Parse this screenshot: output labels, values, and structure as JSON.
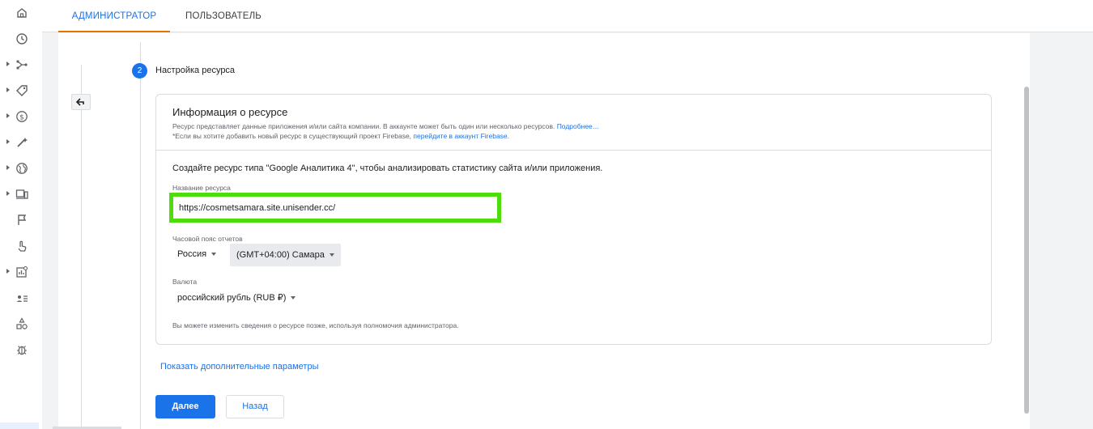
{
  "colors": {
    "accent": "#1a73e8",
    "tab_indicator": "#e37400",
    "highlight": "#4cdd0b",
    "text": "#202124",
    "muted": "#5f6368"
  },
  "sidebar": {
    "items": [
      {
        "icon": "home-icon",
        "expandable": false
      },
      {
        "icon": "clock-icon",
        "expandable": false
      },
      {
        "icon": "branch-icon",
        "expandable": true
      },
      {
        "icon": "tag-icon",
        "expandable": true
      },
      {
        "icon": "dollar-icon",
        "expandable": true
      },
      {
        "icon": "wand-icon",
        "expandable": true
      },
      {
        "icon": "globe-icon",
        "expandable": true
      },
      {
        "icon": "devices-icon",
        "expandable": true
      },
      {
        "icon": "flag-icon",
        "expandable": false
      },
      {
        "icon": "touch-icon",
        "expandable": false
      },
      {
        "icon": "report-icon",
        "expandable": true
      },
      {
        "icon": "user-list-icon",
        "expandable": false
      },
      {
        "icon": "shapes-icon",
        "expandable": false
      },
      {
        "icon": "bug-icon",
        "expandable": false
      }
    ]
  },
  "tabs": {
    "admin": "Администратор",
    "user": "Пользователь"
  },
  "step": {
    "number": "2",
    "title": "Настройка ресурса"
  },
  "card": {
    "title": "Информация о ресурсе",
    "desc1": "Ресурс представляет данные приложения и/или сайта компании. В аккаунте может быть один или несколько ресурсов. ",
    "desc1_link": "Подробнее…",
    "desc2": "*Если вы хотите добавить новый ресурс в существующий проект Firebase, ",
    "desc2_link": "перейдите в аккаунт Firebase",
    "desc2_end": ".",
    "intro": "Создайте ресурс типа \"Google Аналитика 4\", чтобы анализировать статистику сайта и/или приложения.",
    "name_label": "Название ресурса",
    "name_value": "https://cosmetsamara.site.unisender.cc/",
    "tz_label": "Часовой пояс отчетов",
    "country": "Россия",
    "timezone": "(GMT+04:00) Самара",
    "currency_label": "Валюта",
    "currency": "российский рубль (RUB ₽)",
    "note": "Вы можете изменить сведения о ресурсе позже, используя полномочия администратора."
  },
  "more_link": "Показать дополнительные параметры",
  "buttons": {
    "next": "Далее",
    "back": "Назад"
  }
}
